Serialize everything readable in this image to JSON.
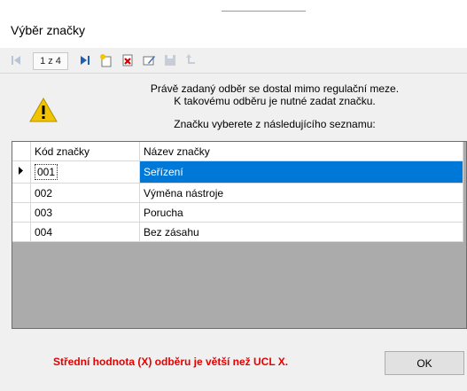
{
  "window": {
    "title": "Výběr značky"
  },
  "toolbar": {
    "pager": "1 z 4",
    "icons": [
      "first-record-icon",
      "next-record-icon",
      "last-record-icon",
      "new-record-icon",
      "delete-record-icon",
      "edit-record-icon",
      "save-record-icon",
      "undo-icon"
    ]
  },
  "message": {
    "line1": "Právě zadaný odběr se dostal mimo regulační meze.",
    "line2": "K takovému odběru je nutné zadat značku.",
    "line3": "Značku vyberete z následujícího seznamu:"
  },
  "table": {
    "columns": [
      "Kód značky",
      "Název značky"
    ],
    "rows": [
      {
        "code": "001",
        "name": "Seřízení"
      },
      {
        "code": "002",
        "name": "Výměna nástroje"
      },
      {
        "code": "003",
        "name": "Porucha"
      },
      {
        "code": "004",
        "name": "Bez zásahu"
      }
    ],
    "selected_index": 0
  },
  "status": {
    "error": "Střední hodnota (X) odběru je větší než UCL X."
  },
  "buttons": {
    "ok": "OK"
  },
  "colors": {
    "selection": "#0078d7",
    "error": "#e60000",
    "warning": "#f2c400"
  }
}
